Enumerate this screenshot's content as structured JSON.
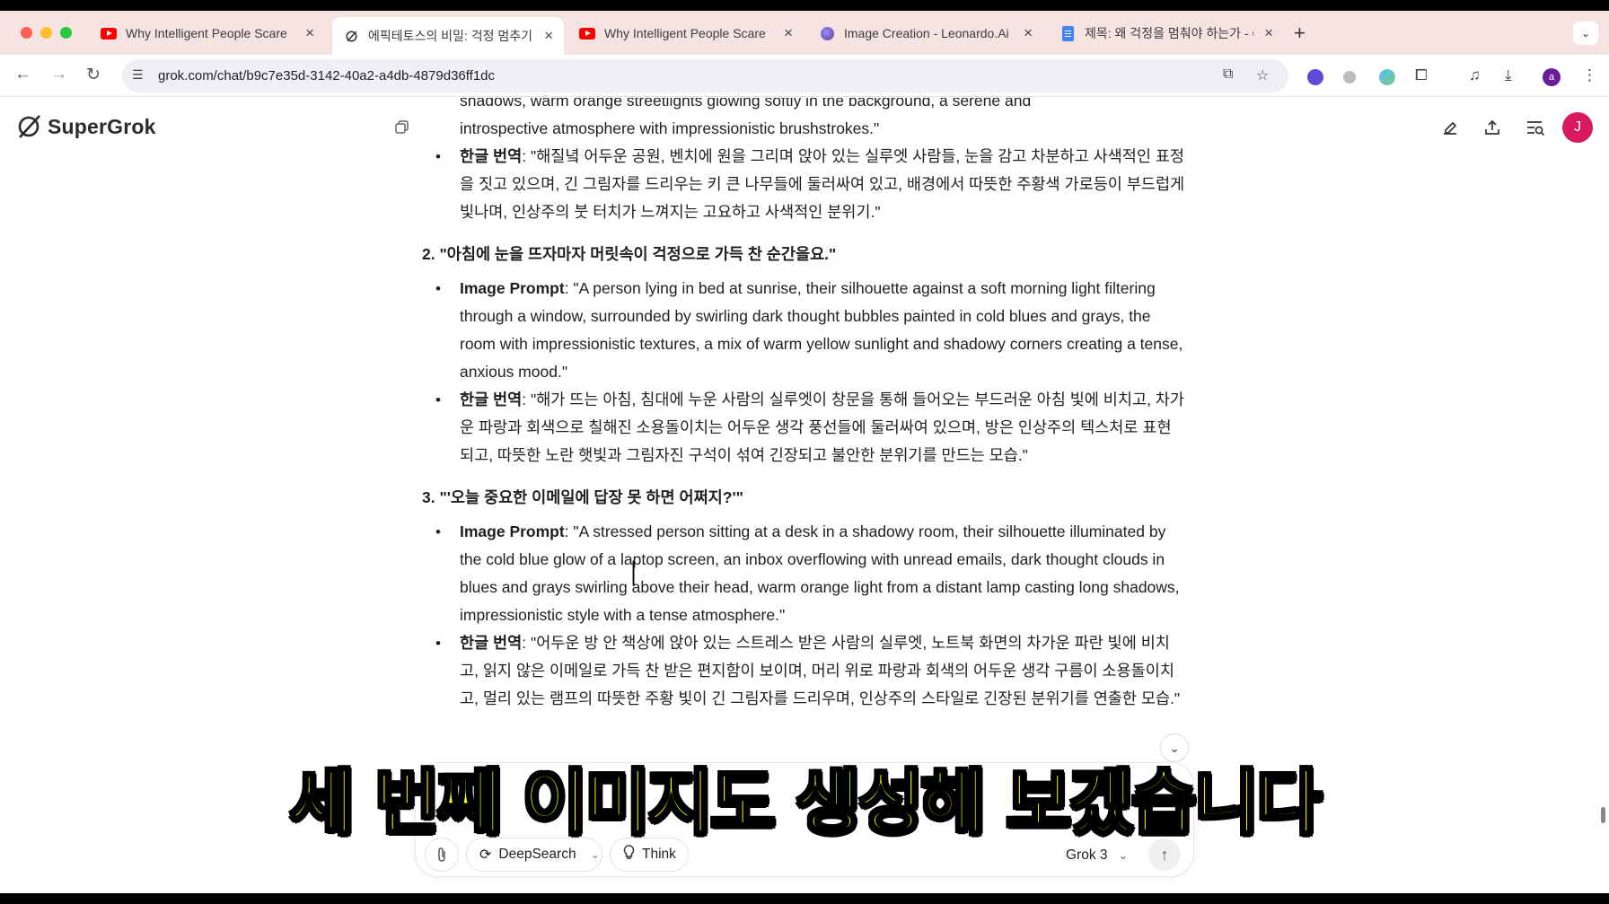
{
  "browser": {
    "tabs": [
      {
        "title": "Why Intelligent People Scare",
        "icon": "youtube-icon",
        "active": false
      },
      {
        "title": "에픽테토스의 비밀: 걱정 멈추기 - (",
        "icon": "grok-icon",
        "active": true
      },
      {
        "title": "Why Intelligent People Scare",
        "icon": "youtube-icon",
        "active": false
      },
      {
        "title": "Image Creation - Leonardo.Ai",
        "icon": "leonardo-icon",
        "active": false
      },
      {
        "title": "제목: 왜 걱정을 멈춰야 하는가 - G",
        "icon": "docs-icon",
        "active": false
      }
    ],
    "url": "grok.com/chat/b9c7e35d-3142-40a2-a4db-4879d36ff1dc",
    "profile_initial": "a"
  },
  "app": {
    "name": "SuperGrok",
    "avatar_initial": "J"
  },
  "conversation": {
    "partial_top": [
      "shadows, warm orange streetlights glowing softly in the background, a serene and",
      "introspective atmosphere with impressionistic brushstrokes.\""
    ],
    "item1_translation": {
      "label": "한글 번역",
      "text": ": \"해질녘 어두운 공원, 벤치에 원을 그리며 앉아 있는 실루엣 사람들, 눈을 감고 차분하고 사색적인 표정을 짓고 있으며, 긴 그림자를 드리우는 키 큰 나무들에 둘러싸여 있고, 배경에서 따뜻한 주황색 가로등이 부드럽게 빛나며, 인상주의 붓 터치가 느껴지는 고요하고 사색적인 분위기.\""
    },
    "sections": [
      {
        "heading": "2. \"아침에 눈을 뜨자마자 머릿속이 걱정으로 가득 찬 순간을요.\"",
        "prompt_label": "Image Prompt",
        "prompt_text": ": \"A person lying in bed at sunrise, their silhouette against a soft morning light filtering through a window, surrounded by swirling dark thought bubbles painted in cold blues and grays, the room with impressionistic textures, a mix of warm yellow sunlight and shadowy corners creating a tense, anxious mood.\"",
        "translation_label": "한글 번역",
        "translation_text": ": \"해가 뜨는 아침, 침대에 누운 사람의 실루엣이 창문을 통해 들어오는 부드러운 아침 빛에 비치고, 차가운 파랑과 회색으로 칠해진 소용돌이치는 어두운 생각 풍선들에 둘러싸여 있으며, 방은 인상주의 텍스처로 표현되고, 따뜻한 노란 햇빛과 그림자진 구석이 섞여 긴장되고 불안한 분위기를 만드는 모습.\""
      },
      {
        "heading": "3. \"'오늘 중요한 이메일에 답장 못 하면 어쩌지?'\"",
        "prompt_label": "Image Prompt",
        "prompt_text": ": \"A stressed person sitting at a desk in a shadowy room, their silhouette illuminated by the cold blue glow of a laptop screen, an inbox overflowing with unread emails, dark thought clouds in blues and grays swirling above their head, warm orange light from a distant lamp casting long shadows, impressionistic style with a tense atmosphere.\"",
        "translation_label": "한글 번역",
        "translation_text": ": \"어두운 방 안 책상에 앉아 있는 스트레스 받은 사람의 실루엣, 노트북 화면의 차가운 파란 빛에 비치고, 읽지 않은 이메일로 가득 찬 받은 편지함이 보이며, 머리 위로 파랑과 회색의 어두운 생각 구름이 소용돌이치고, 멀리 있는 램프의 따뜻한 주황 빛이 긴 그림자를 드리우며, 인상주의 스타일로 긴장된 분위기를 연출한 모습.\""
      }
    ]
  },
  "composer": {
    "deepsearch_label": "DeepSearch",
    "think_label": "Think",
    "model_label": "Grok 3"
  },
  "caption": "세 번째 이미지도 생성해 보겠습니다",
  "colors": {
    "caption": "#ffff00",
    "tabstrip": "#f4e3e0",
    "avatar": "#d81b60"
  }
}
